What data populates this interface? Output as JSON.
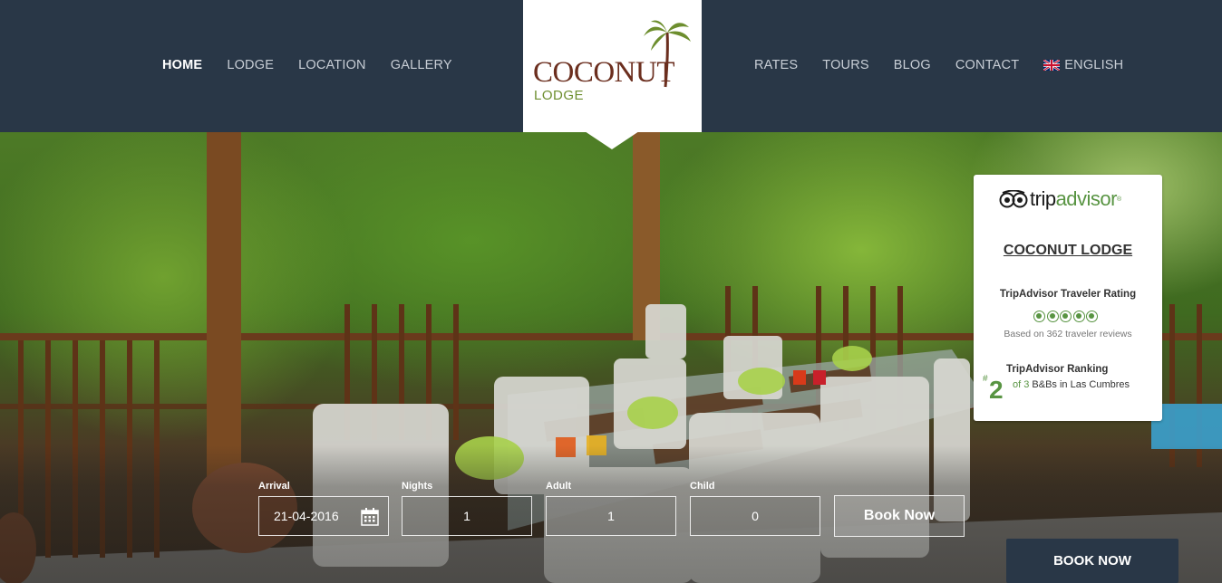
{
  "nav_left": [
    {
      "label": "HOME",
      "active": true
    },
    {
      "label": "LODGE",
      "active": false
    },
    {
      "label": "LOCATION",
      "active": false
    },
    {
      "label": "GALLERY",
      "active": false
    }
  ],
  "nav_right": [
    {
      "label": "RATES"
    },
    {
      "label": "TOURS"
    },
    {
      "label": "BLOG"
    },
    {
      "label": "CONTACT"
    }
  ],
  "language": {
    "label": "ENGLISH",
    "icon": "uk-flag-icon"
  },
  "logo": {
    "word": "COCONUT",
    "sub": "LODGE",
    "icon": "palm-tree-icon"
  },
  "booking": {
    "arrival": {
      "label": "Arrival",
      "value": "21-04-2016"
    },
    "nights": {
      "label": "Nights",
      "value": "1"
    },
    "adult": {
      "label": "Adult",
      "value": "1"
    },
    "child": {
      "label": "Child",
      "value": "0"
    },
    "submit_label": "Book Now"
  },
  "book_now_tab": "BOOK NOW",
  "tripadvisor": {
    "brand_trip": "trip",
    "brand_advisor": "advisor",
    "property_name": "COCONUT LODGE",
    "rating_title": "TripAdvisor Traveler Rating",
    "rating_bubbles": 5,
    "based_on": "Based on 362 traveler reviews",
    "ranking_title": "TripAdvisor Ranking",
    "rank_hash": "#",
    "rank_number": "2",
    "rank_of": "of 3",
    "rank_desc": "B&Bs in Las Cumbres"
  },
  "colors": {
    "header_bg": "#293747",
    "logo_brown": "#6b2e1e",
    "logo_green": "#6d8e2e",
    "tripadvisor_green": "#589442"
  }
}
